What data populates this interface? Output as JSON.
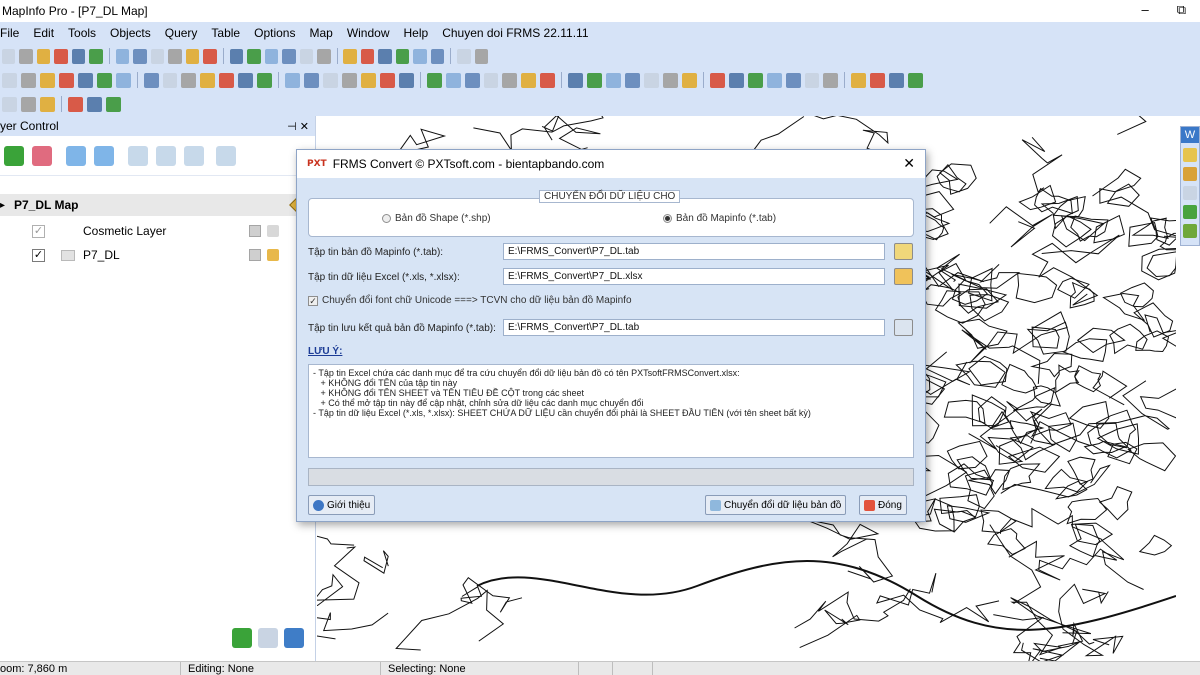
{
  "window": {
    "title": "MapInfo Pro - [P7_DL Map]",
    "minimize": "–",
    "restore": "⧉"
  },
  "menu": [
    "File",
    "Edit",
    "Tools",
    "Objects",
    "Query",
    "Table",
    "Options",
    "Map",
    "Window",
    "Help",
    "Chuyen doi FRMS 22.11.11"
  ],
  "layer_control": {
    "title": "yer Control",
    "pin": "⊣ ✕",
    "map_name": "P7_DL Map",
    "layers": [
      {
        "name": "Cosmetic Layer",
        "checked": true
      },
      {
        "name": "P7_DL",
        "checked": true
      }
    ]
  },
  "right_toolbar": {
    "label": "W"
  },
  "status": {
    "zoom": "oom: 7,860 m",
    "editing": "Editing: None",
    "selecting": "Selecting: None"
  },
  "dialog": {
    "brand": "PXT",
    "title": "FRMS Convert © PXTsoft.com - bientapbando.com",
    "close": "✕",
    "group_label": "CHUYỂN ĐỔI DỮ LIỆU CHO",
    "radio_shape": "Bản đồ Shape (*.shp)",
    "radio_mapinfo": "Bản đồ Mapinfo (*.tab)",
    "selected_radio": "mapinfo",
    "field1_label": "Tập tin bản đồ Mapinfo (*.tab):",
    "field1_value": "E:\\FRMS_Convert\\P7_DL.tab",
    "field2_label": "Tập tin dữ liệu Excel (*.xls, *.xlsx):",
    "field2_value": "E:\\FRMS_Convert\\P7_DL.xlsx",
    "unicode_check": "Chuyển đổi font chữ Unicode ===> TCVN cho dữ liệu bản đồ Mapinfo",
    "unicode_checked": true,
    "field3_label": "Tập tin lưu kết quả bản đồ Mapinfo (*.tab):",
    "field3_value": "E:\\FRMS_Convert\\P7_DL.tab",
    "note_heading": "LƯU Ý:",
    "notes": [
      "- Tập tin Excel chứa các danh mục để tra cứu chuyển đổi dữ liệu bản đồ có tên PXTsoftFRMSConvert.xlsx:",
      "   + KHÔNG đổi TÊN của tập tin này",
      "   + KHÔNG đổi TÊN SHEET và TÊN TIÊU ĐỀ CỘT trong các sheet",
      "   + Có thể mở tập tin này để cập nhật, chỉnh sửa dữ liệu các danh mục chuyển đổi",
      "- Tập tin dữ liệu Excel (*.xls, *.xlsx): SHEET CHỨA DỮ LIỆU cần chuyển đổi phải là SHEET ĐẦU TIÊN (với tên sheet bất kỳ)"
    ],
    "progress": 0,
    "btn_intro": "Giới thiệu",
    "btn_convert": "Chuyển đổi dữ liệu bản đồ",
    "btn_close": "Đóng"
  }
}
